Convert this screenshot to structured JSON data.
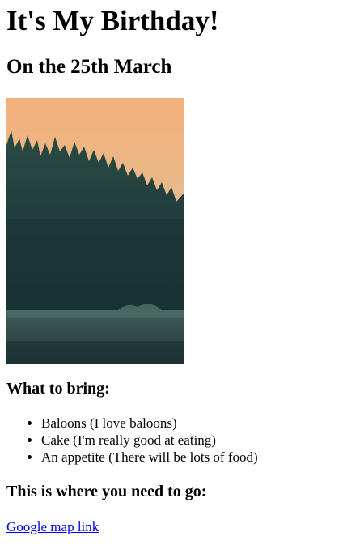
{
  "page": {
    "title": "It's My Birthday!",
    "date_heading": "On the 25th March"
  },
  "photo": {
    "description_icon": "forest-sunset-image"
  },
  "bring": {
    "heading": "What to bring:",
    "items": [
      "Baloons (I love baloons)",
      "Cake (I'm really good at eating)",
      "An appetite (There will be lots of food)"
    ]
  },
  "location": {
    "heading": "This is where you need to go:",
    "link_text": "Google map link"
  },
  "colors": {
    "link": "#0000ee",
    "text": "#000000"
  }
}
